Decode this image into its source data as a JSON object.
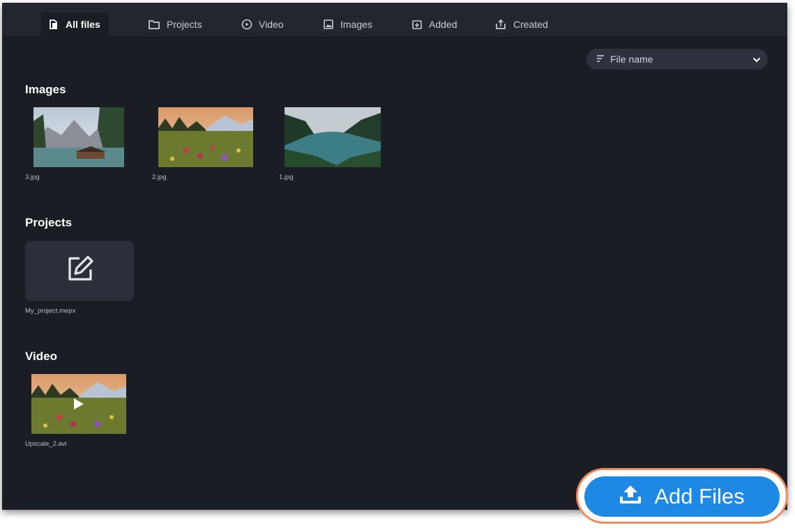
{
  "tabs": [
    {
      "label": "All files",
      "icon": "files-icon",
      "active": true
    },
    {
      "label": "Projects",
      "icon": "folder-icon"
    },
    {
      "label": "Video",
      "icon": "play-circle-icon"
    },
    {
      "label": "Images",
      "icon": "image-icon"
    },
    {
      "label": "Added",
      "icon": "added-icon"
    },
    {
      "label": "Created",
      "icon": "export-icon"
    }
  ],
  "sort": {
    "label": "File name",
    "icon": "sort-icon",
    "chevron": "chevron-down-icon"
  },
  "sections": {
    "images": {
      "title": "Images",
      "items": [
        {
          "name": "3.jpg"
        },
        {
          "name": "2.jpg"
        },
        {
          "name": "1.jpg"
        }
      ]
    },
    "projects": {
      "title": "Projects",
      "items": [
        {
          "name": "My_project.mepx",
          "icon": "edit-icon"
        }
      ]
    },
    "video": {
      "title": "Video",
      "items": [
        {
          "name": "Upscale_2.avi",
          "icon": "play-icon"
        }
      ]
    }
  },
  "add_button": {
    "label": "Add Files",
    "icon": "upload-icon",
    "color": "#1e88e5",
    "highlight_color": "#f08a5d"
  }
}
